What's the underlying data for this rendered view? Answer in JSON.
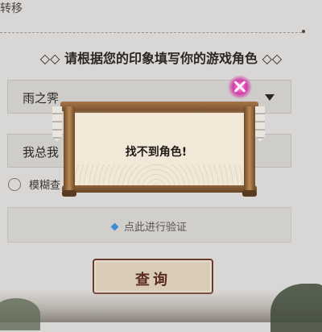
{
  "top": {
    "text": "转移"
  },
  "form": {
    "prompt": "请根据您的印象填写你的游戏角色",
    "server_value": "雨之霁",
    "role_value": "我总我",
    "fuzzy_label": "模糊查",
    "verify_label": "点此进行验证",
    "query_label": "查询"
  },
  "dialog": {
    "message": "找不到角色!"
  },
  "icons": {
    "prompt_ornament": "diamond-ornament-icon",
    "select_caret": "chevron-down-icon",
    "verify": "shield-verify-icon",
    "close": "close-icon"
  },
  "colors": {
    "close_glow": "#d23ca8",
    "scroll_wood": "#8c6a44",
    "query_border": "#6b3b2a",
    "verify_icon": "#3c8ed6"
  }
}
